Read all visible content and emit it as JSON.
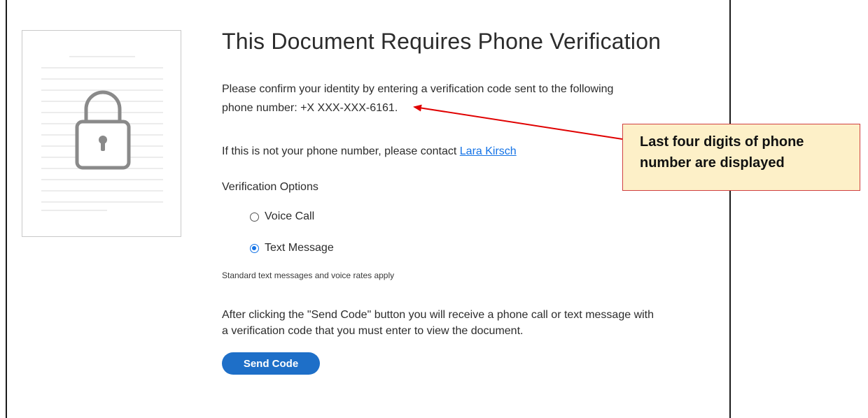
{
  "page": {
    "title": "This Document Requires Phone Verification",
    "intro_line1": "Please confirm your identity by entering a verification code sent to the following",
    "intro_line2": "phone number: +X XXX-XXX-6161.",
    "contact_prefix": "If this is not your phone number, please contact ",
    "contact_link": "Lara Kirsch",
    "options_label": "Verification Options",
    "options": [
      {
        "label": "Voice Call",
        "selected": false
      },
      {
        "label": "Text Message",
        "selected": true
      }
    ],
    "rates_note": "Standard text messages and voice rates apply",
    "after_line1": "After clicking the \"Send Code\" button you will receive a phone call or text message with",
    "after_line2": "a verification code that you must enter to view the document.",
    "send_button": "Send Code"
  },
  "annotation": {
    "callout_line1": "Last four digits of phone",
    "callout_line2": "number are displayed"
  },
  "colors": {
    "accent": "#1473e6",
    "button": "#1e6fc8",
    "callout_bg": "#fdf0c8",
    "callout_border": "#d04040"
  },
  "icons": {
    "document": "document-icon",
    "lock": "lock-icon",
    "arrow": "arrow-icon"
  }
}
